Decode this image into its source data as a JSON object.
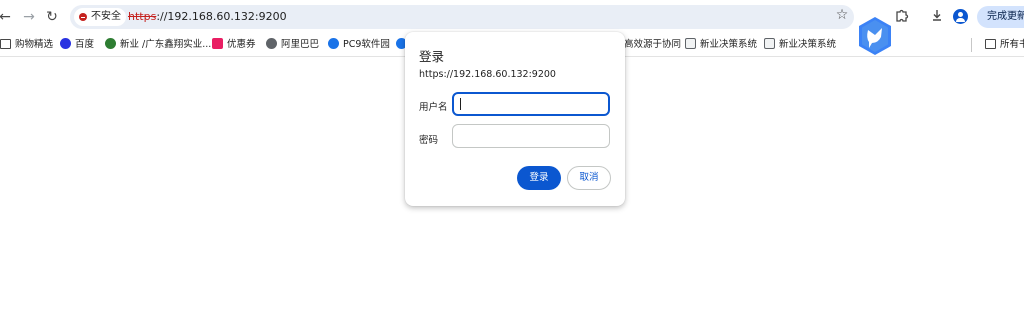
{
  "toolbar": {
    "back_icon": "back-arrow-icon",
    "forward_icon": "forward-arrow-icon",
    "reload_icon": "reload-icon",
    "security_label": "不安全",
    "url_scheme": "https",
    "url_rest": "://192.168.60.132:9200",
    "update_label": "完成更新"
  },
  "bookmarks": [
    {
      "label": "购物精选",
      "icon": "folder-icon",
      "color": "#474747"
    },
    {
      "label": "百度",
      "icon": "baidu-paw-icon",
      "color": "#2932e1"
    },
    {
      "label": "新业 /广东鑫翔实业...",
      "icon": "gear-icon",
      "color": "#2e7d32"
    },
    {
      "label": "优惠券",
      "icon": "coupon-icon",
      "color": "#e91e63"
    },
    {
      "label": "阿里巴巴",
      "icon": "globe-icon",
      "color": "#5f6368"
    },
    {
      "label": "PC9软件园",
      "icon": "pc9-icon",
      "color": "#1a73e8"
    },
    {
      "label": "",
      "icon": "pc9-icon",
      "color": "#1a73e8"
    },
    {
      "label": "高效源于协同",
      "icon": "",
      "color": ""
    },
    {
      "label": "新业决策系统",
      "icon": "image-icon",
      "color": "#5f6368"
    },
    {
      "label": "新业决策系统",
      "icon": "image-icon",
      "color": "#5f6368"
    },
    {
      "label": "所有书",
      "icon": "folder-icon",
      "color": "#474747"
    }
  ],
  "dialog": {
    "title": "登录",
    "origin": "https://192.168.60.132:9200",
    "username_label": "用户名",
    "username_value": "",
    "password_label": "密码",
    "password_value": "",
    "login_button": "登录",
    "cancel_button": "取消"
  },
  "colors": {
    "accent": "#0b57d0",
    "warning": "#c5221f",
    "omnibox_bg": "#e9eef6"
  }
}
